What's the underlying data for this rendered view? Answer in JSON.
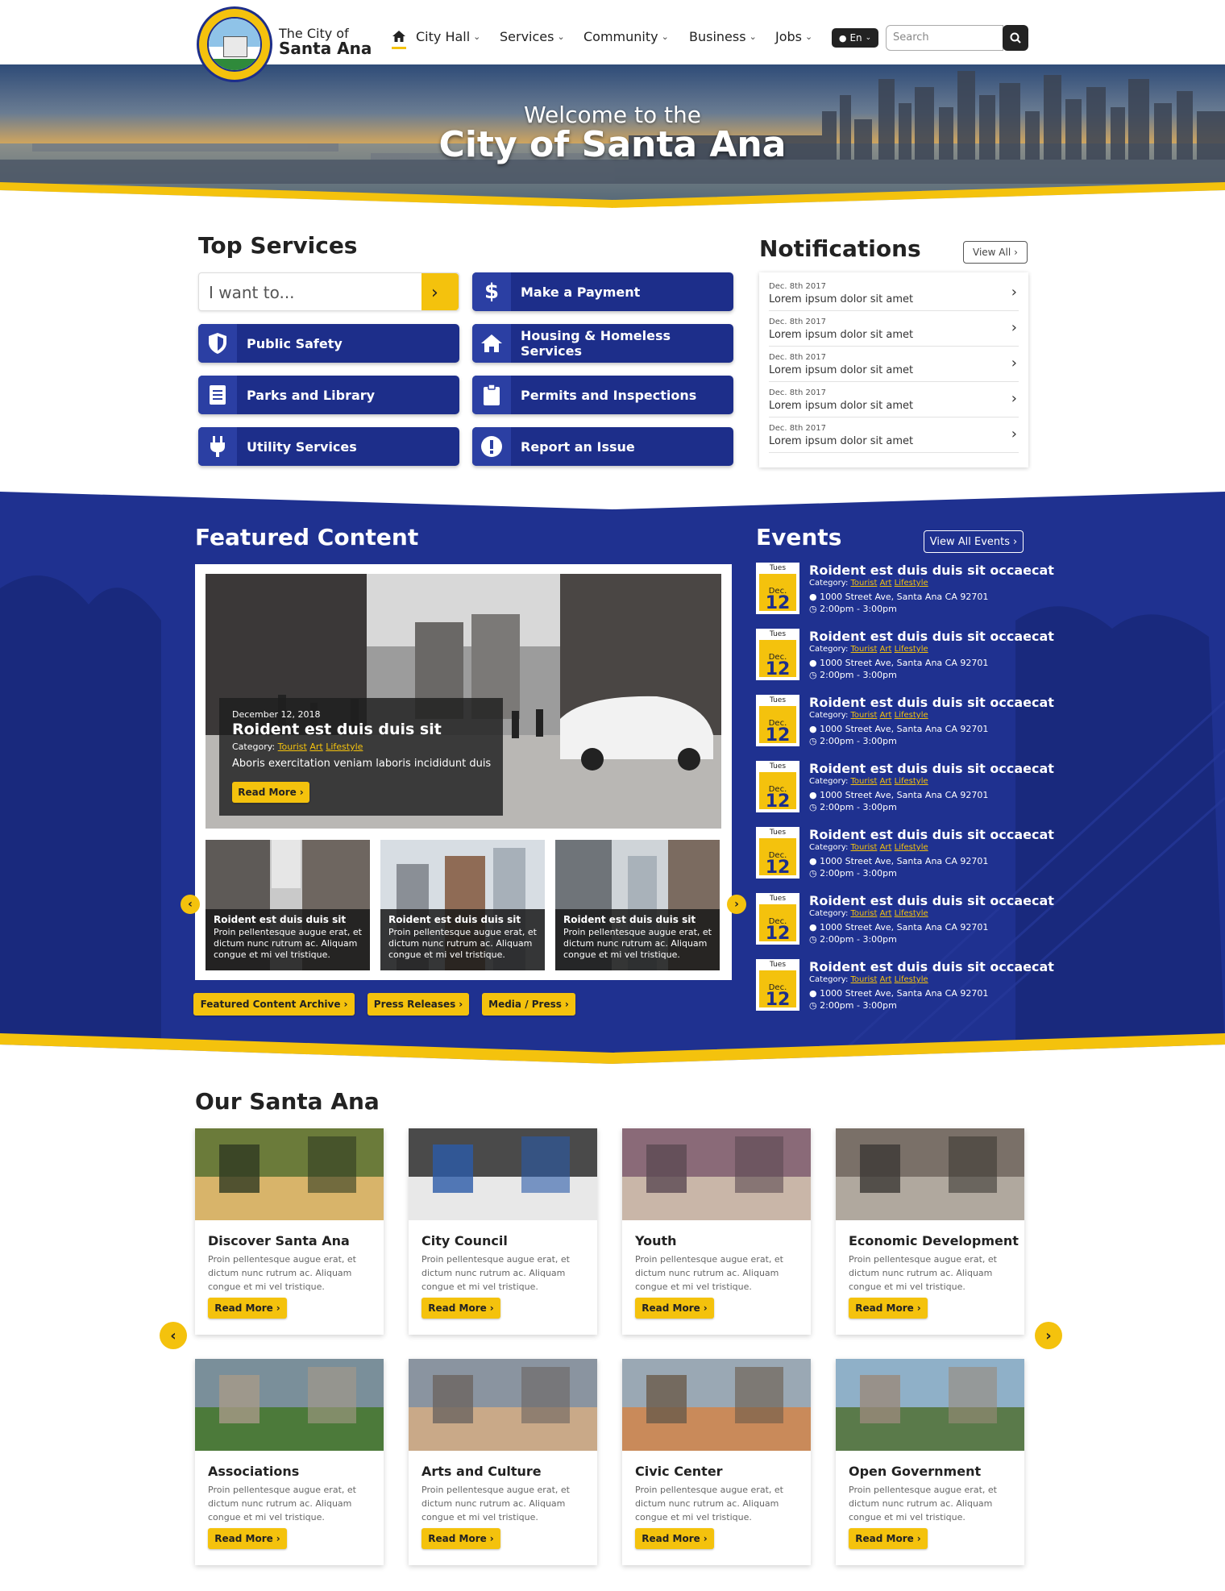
{
  "brand": {
    "line1": "The City of",
    "line2": "Santa Ana"
  },
  "nav": [
    {
      "label": "City Hall"
    },
    {
      "label": "Services"
    },
    {
      "label": "Community"
    },
    {
      "label": "Business"
    },
    {
      "label": "Jobs"
    }
  ],
  "lang": "En",
  "search": {
    "placeholder": "Search"
  },
  "hero": {
    "line1": "Welcome to the",
    "line2": "City of Santa Ana"
  },
  "top_services": {
    "title": "Top Services",
    "iwant_placeholder": "I want to...",
    "items": [
      {
        "label": "Make a Payment",
        "icon": "dollar-icon"
      },
      {
        "label": "Public Safety",
        "icon": "shield-icon"
      },
      {
        "label": "Housing & Homeless Services",
        "icon": "house-icon"
      },
      {
        "label": "Parks and Library",
        "icon": "book-icon"
      },
      {
        "label": "Permits and Inspections",
        "icon": "clipboard-icon"
      },
      {
        "label": "Utility Services",
        "icon": "plug-icon"
      },
      {
        "label": "Report an Issue",
        "icon": "alert-icon"
      }
    ]
  },
  "notifications": {
    "title": "Notifications",
    "view_all": "View All",
    "items": [
      {
        "date": "Dec. 8th 2017",
        "text": "Lorem ipsum dolor sit amet"
      },
      {
        "date": "Dec. 8th 2017",
        "text": "Lorem ipsum dolor sit amet"
      },
      {
        "date": "Dec. 8th 2017",
        "text": "Lorem ipsum dolor sit amet"
      },
      {
        "date": "Dec. 8th 2017",
        "text": "Lorem ipsum dolor sit amet"
      },
      {
        "date": "Dec. 8th 2017",
        "text": "Lorem ipsum dolor sit amet"
      }
    ]
  },
  "featured": {
    "title": "Featured Content",
    "main": {
      "date": "December 12, 2018",
      "title": "Roident est duis duis sit",
      "category_label": "Category:",
      "categories": [
        "Tourist",
        "Art",
        "Lifestyle"
      ],
      "desc": "Aboris exercitation veniam laboris incididunt duis",
      "read_more": "Read More"
    },
    "thumbs": [
      {
        "title": "Roident est duis duis sit",
        "text": "Proin pellentesque augue erat, et dictum nunc rutrum ac. Aliquam congue et mi vel tristique."
      },
      {
        "title": "Roident est duis duis sit",
        "text": "Proin pellentesque augue erat, et dictum nunc rutrum ac. Aliquam congue et mi vel tristique."
      },
      {
        "title": "Roident est duis duis sit",
        "text": "Proin pellentesque augue erat, et dictum nunc rutrum ac. Aliquam congue et mi vel tristique."
      }
    ],
    "links": [
      "Featured Content Archive",
      "Press Releases",
      "Media / Press"
    ]
  },
  "events": {
    "title": "Events",
    "view_all": "View All Events",
    "items": [
      {
        "day": "Tues",
        "month": "Dec.",
        "num": "12",
        "title": "Roident est duis duis sit occaecat",
        "category_label": "Category:",
        "categories": [
          "Tourist",
          "Art",
          "Lifestyle"
        ],
        "address": "1000 Street Ave, Santa Ana CA 92701",
        "time": "2:00pm - 3:00pm"
      },
      {
        "day": "Tues",
        "month": "Dec.",
        "num": "12",
        "title": "Roident est duis duis sit occaecat",
        "category_label": "Category:",
        "categories": [
          "Tourist",
          "Art",
          "Lifestyle"
        ],
        "address": "1000 Street Ave, Santa Ana CA 92701",
        "time": "2:00pm - 3:00pm"
      },
      {
        "day": "Tues",
        "month": "Dec.",
        "num": "12",
        "title": "Roident est duis duis sit occaecat",
        "category_label": "Category:",
        "categories": [
          "Tourist",
          "Art",
          "Lifestyle"
        ],
        "address": "1000 Street Ave, Santa Ana CA 92701",
        "time": "2:00pm - 3:00pm"
      },
      {
        "day": "Tues",
        "month": "Dec.",
        "num": "12",
        "title": "Roident est duis duis sit occaecat",
        "category_label": "Category:",
        "categories": [
          "Tourist",
          "Art",
          "Lifestyle"
        ],
        "address": "1000 Street Ave, Santa Ana CA 92701",
        "time": "2:00pm - 3:00pm"
      },
      {
        "day": "Tues",
        "month": "Dec.",
        "num": "12",
        "title": "Roident est duis duis sit occaecat",
        "category_label": "Category:",
        "categories": [
          "Tourist",
          "Art",
          "Lifestyle"
        ],
        "address": "1000 Street Ave, Santa Ana CA 92701",
        "time": "2:00pm - 3:00pm"
      },
      {
        "day": "Tues",
        "month": "Dec.",
        "num": "12",
        "title": "Roident est duis duis sit occaecat",
        "category_label": "Category:",
        "categories": [
          "Tourist",
          "Art",
          "Lifestyle"
        ],
        "address": "1000 Street Ave, Santa Ana CA 92701",
        "time": "2:00pm - 3:00pm"
      },
      {
        "day": "Tues",
        "month": "Dec.",
        "num": "12",
        "title": "Roident est duis duis sit occaecat",
        "category_label": "Category:",
        "categories": [
          "Tourist",
          "Art",
          "Lifestyle"
        ],
        "address": "1000 Street Ave, Santa Ana CA 92701",
        "time": "2:00pm - 3:00pm"
      }
    ]
  },
  "our_santa_ana": {
    "title": "Our Santa Ana",
    "read_more": "Read More",
    "cards": [
      {
        "title": "Discover Santa Ana",
        "text": "Proin pellentesque augue erat, et dictum nunc rutrum ac. Aliquam congue et mi vel tristique."
      },
      {
        "title": "City Council",
        "text": "Proin pellentesque augue erat, et dictum nunc rutrum ac. Aliquam congue et mi vel tristique."
      },
      {
        "title": "Youth",
        "text": "Proin pellentesque augue erat, et dictum nunc rutrum ac. Aliquam congue et mi vel tristique."
      },
      {
        "title": "Economic Development",
        "text": "Proin pellentesque augue erat, et dictum nunc rutrum ac. Aliquam congue et mi vel tristique."
      },
      {
        "title": "Associations",
        "text": "Proin pellentesque augue erat, et dictum nunc rutrum ac. Aliquam congue et mi vel tristique."
      },
      {
        "title": "Arts and Culture",
        "text": "Proin pellentesque augue erat, et dictum nunc rutrum ac. Aliquam congue et mi vel tristique."
      },
      {
        "title": "Civic Center",
        "text": "Proin pellentesque augue erat, et dictum nunc rutrum ac. Aliquam congue et mi vel tristique."
      },
      {
        "title": "Open Government",
        "text": "Proin pellentesque augue erat, et dictum nunc rutrum ac. Aliquam congue et mi vel tristique."
      }
    ]
  },
  "colors": {
    "navy": "#1d2e8a",
    "yellow": "#f4c20d",
    "blue_section": "#1f3190"
  }
}
